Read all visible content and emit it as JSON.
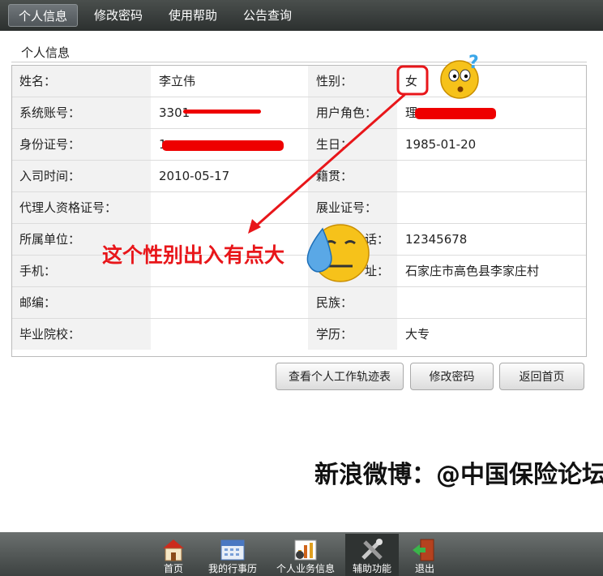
{
  "nav": {
    "tabs": [
      "个人信息",
      "修改密码",
      "使用帮助",
      "公告查询"
    ]
  },
  "section_title": "个人信息",
  "rows": [
    {
      "l1": "姓名：",
      "v1": "李立伟",
      "l2": "性别：",
      "v2": "女"
    },
    {
      "l1": "系统账号：",
      "v1": "3301",
      "l2": "用户角色：",
      "v2": "理"
    },
    {
      "l1": "身份证号：",
      "v1": "1",
      "l2": "生日：",
      "v2": "1985-01-20"
    },
    {
      "l1": "入司时间：",
      "v1": "2010-05-17",
      "l2": "籍贯：",
      "v2": ""
    },
    {
      "l1": "代理人资格证号：",
      "v1": "",
      "l2": "展业证号：",
      "v2": ""
    },
    {
      "l1": "所属单位：",
      "v1": "",
      "l2": "话：",
      "v2": "12345678"
    },
    {
      "l1": "手机：",
      "v1": "",
      "l2": "址：",
      "v2": "石家庄市高色县李家庄村"
    },
    {
      "l1": "邮编：",
      "v1": "",
      "l2": "民族：",
      "v2": ""
    },
    {
      "l1": "毕业院校：",
      "v1": "",
      "l2": "学历：",
      "v2": "大专"
    }
  ],
  "buttons": {
    "track": "查看个人工作轨迹表",
    "password": "修改密码",
    "home": "返回首页"
  },
  "annotation": "这个性别出入有点大",
  "watermark": "新浪微博：@中国保险论坛",
  "bottom_nav": [
    {
      "label": "首页",
      "icon": "home-icon"
    },
    {
      "label": "我的行事历",
      "icon": "calendar-icon"
    },
    {
      "label": "个人业务信息",
      "icon": "chart-icon"
    },
    {
      "label": "辅助功能",
      "icon": "tools-icon"
    },
    {
      "label": "退出",
      "icon": "exit-door-icon"
    }
  ],
  "colors": {
    "annotation_red": "#e8161a",
    "nav_dark": "#3d4241"
  }
}
